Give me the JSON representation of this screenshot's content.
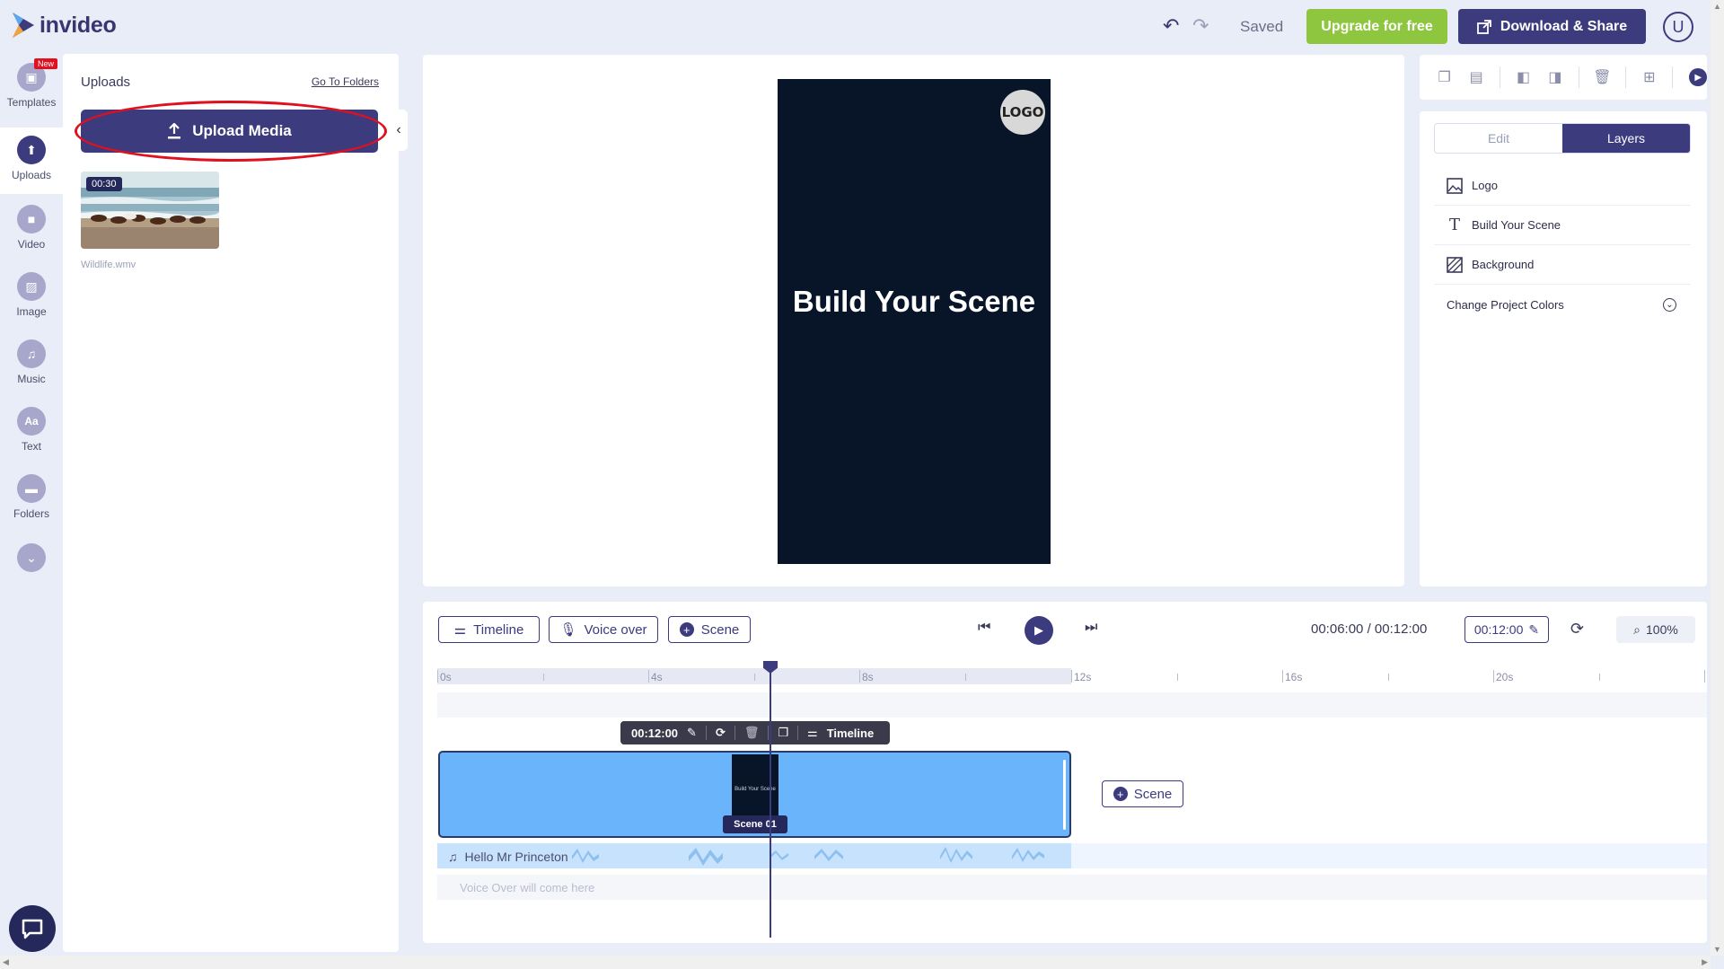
{
  "app": {
    "logo_text": "invideo",
    "saved_label": "Saved",
    "upgrade_label": "Upgrade for free",
    "download_label": "Download & Share",
    "avatar_letter": "U",
    "brand_color": "#3c3b7e",
    "upgrade_color": "#8ec63f"
  },
  "rail": {
    "items": [
      {
        "label": "Templates",
        "icon": "templates-icon",
        "badge": "New"
      },
      {
        "label": "Uploads",
        "icon": "upload-icon"
      },
      {
        "label": "Video",
        "icon": "video-icon"
      },
      {
        "label": "Image",
        "icon": "image-icon"
      },
      {
        "label": "Music",
        "icon": "music-icon"
      },
      {
        "label": "Text",
        "icon": "text-icon",
        "glyph": "Aa"
      },
      {
        "label": "Folders",
        "icon": "folder-icon"
      }
    ]
  },
  "uploads": {
    "title": "Uploads",
    "goto_folders": "Go To Folders",
    "upload_button": "Upload Media",
    "file": {
      "duration": "00:30",
      "name": "Wildlife.wmv"
    }
  },
  "canvas": {
    "logo_text": "LOGO",
    "title": "Build Your Scene"
  },
  "layers_panel": {
    "tabs": [
      "Edit",
      "Layers"
    ],
    "active_tab": "Layers",
    "layers": [
      {
        "name": "Logo",
        "icon": "image-icon"
      },
      {
        "name": "Build Your Scene",
        "icon": "text-icon"
      },
      {
        "name": "Background",
        "icon": "background-icon"
      }
    ],
    "change_colors": "Change Project Colors"
  },
  "timeline": {
    "timeline_btn": "Timeline",
    "voiceover_btn": "Voice over",
    "scene_btn": "Scene",
    "current_time": "00:06:00",
    "total_time": "00:12:00",
    "time_separator": "/",
    "duration_btn": "00:12:00",
    "zoom": "100%",
    "ruler_labels": [
      "0s",
      "4s",
      "8s",
      "12s",
      "16s",
      "20s"
    ],
    "scene_toolbar_time": "00:12:00",
    "scene_toolbar_timeline": "Timeline",
    "scene_label": "Scene 01",
    "scene_thumb_text": "Build Your Scene",
    "add_scene": "Scene",
    "audio_track": "Hello Mr Princeton",
    "voiceover_placeholder": "Voice Over will come here"
  }
}
